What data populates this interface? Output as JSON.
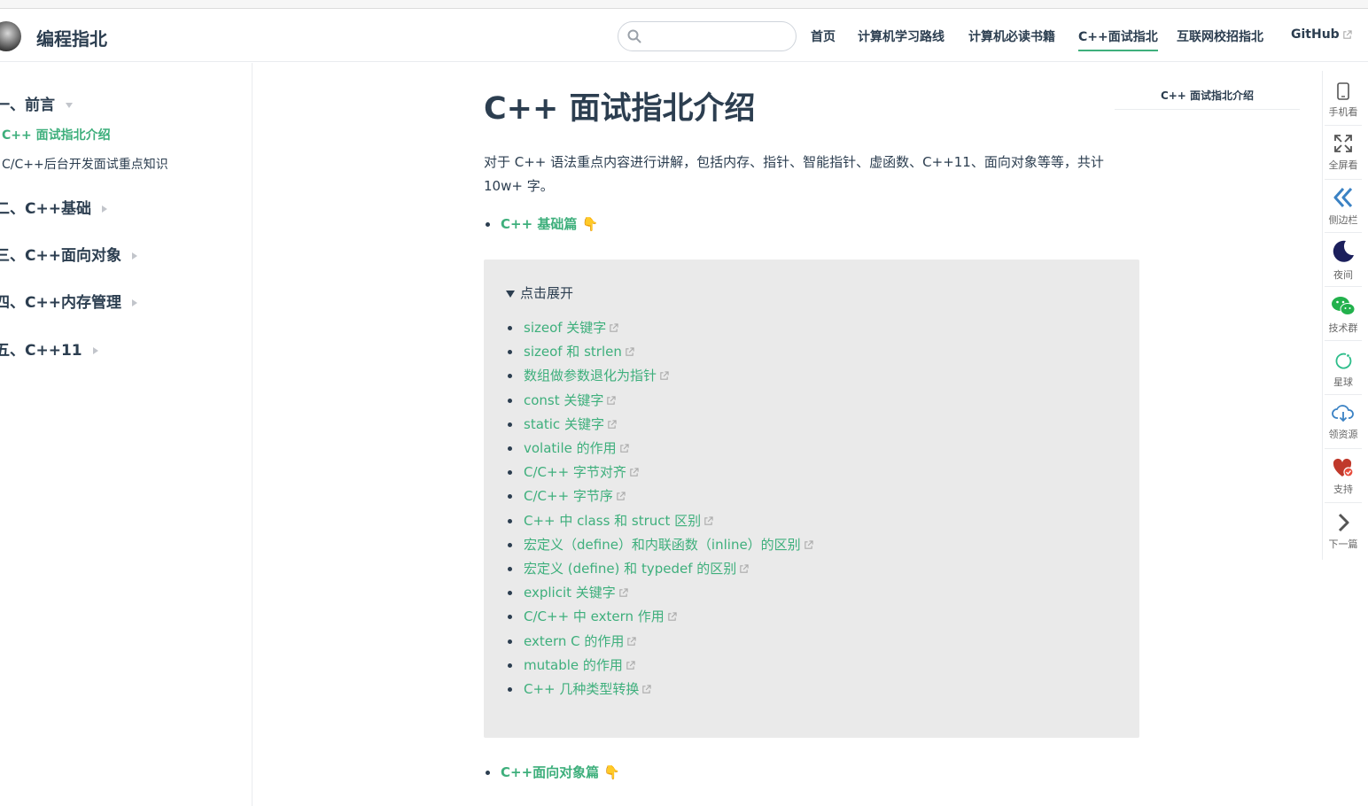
{
  "header": {
    "site_name": "编程指北",
    "search": {
      "value": "",
      "placeholder": ""
    },
    "nav": [
      {
        "label": "首页"
      },
      {
        "label": "计算机学习路线"
      },
      {
        "label": "计算机必读书籍"
      },
      {
        "label": "C++面试指北",
        "active": true
      },
      {
        "label": "互联网校招指北"
      },
      {
        "label": "GitHub",
        "external": true
      }
    ]
  },
  "sidebar": {
    "groups": [
      {
        "label": "一、前言",
        "expanded": true
      },
      {
        "label": "二、C++基础"
      },
      {
        "label": "三、C++面向对象"
      },
      {
        "label": "四、C++内存管理"
      },
      {
        "label": "五、C++11"
      }
    ],
    "items": [
      {
        "label": "C++ 面试指北介绍",
        "active": true
      },
      {
        "label": "C/C++后台开发面试重点知识"
      }
    ]
  },
  "main": {
    "title": "C++ 面试指北介绍",
    "intro": "对于 C++ 语法重点内容进行讲解，包括内存、指针、智能指针、虚函数、C++11、面向对象等等，共计 10w+ 字。",
    "section_basic": "C++ 基础篇 👇",
    "details_summary": "点击展开",
    "details_items": [
      "sizeof 关键字",
      "sizeof 和 strlen",
      "数组做参数退化为指针",
      "const 关键字",
      "static 关键字",
      "volatile 的作用",
      "C/C++ 字节对齐",
      "C/C++ 字节序",
      "C++ 中 class 和 struct 区别",
      "宏定义（define）和内联函数（inline）的区别",
      "宏定义 (define) 和 typedef 的区别",
      "explicit 关键字",
      "C/C++ 中 extern 作用",
      "extern C 的作用",
      "mutable 的作用",
      "C++ 几种类型转换"
    ],
    "section_oop": "C++面向对象篇 👇"
  },
  "toc": {
    "label": "C++ 面试指北介绍"
  },
  "toolbar": {
    "items": [
      {
        "label": "手机看",
        "icon": "phone-icon"
      },
      {
        "label": "全屏看",
        "icon": "fullscreen-icon"
      },
      {
        "label": "侧边栏",
        "icon": "double-chevron-left-icon"
      },
      {
        "label": "夜间",
        "icon": "moon-icon"
      },
      {
        "label": "技术群",
        "icon": "wechat-icon"
      },
      {
        "label": "星球",
        "icon": "planet-icon"
      },
      {
        "label": "领资源",
        "icon": "cloud-download-icon"
      },
      {
        "label": "支持",
        "icon": "heart-icon"
      },
      {
        "label": "下一篇",
        "icon": "chevron-right-icon"
      }
    ]
  },
  "colors": {
    "accent": "#3eaf7c",
    "text": "#2c3e50",
    "details_bg": "#eaeaea"
  }
}
